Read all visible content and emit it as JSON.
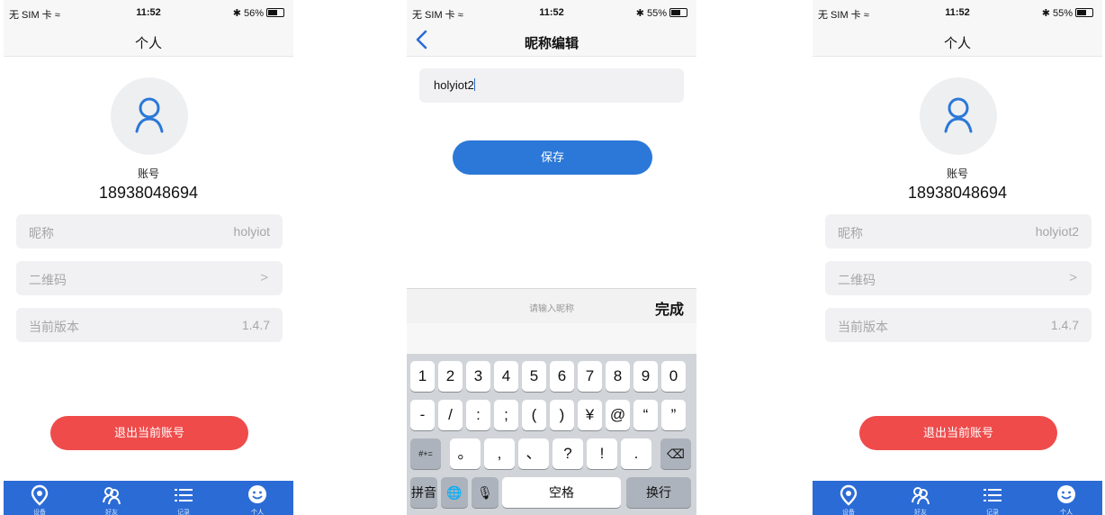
{
  "screens": [
    {
      "status": {
        "carrier": "无 SIM 卡 ≈",
        "time": "11:52",
        "battery": "✱ 56%"
      },
      "title": "个人",
      "account_label": "账号",
      "account_number": "18938048694",
      "rows": [
        {
          "label": "昵称",
          "value": "holyiot"
        },
        {
          "label": "二维码",
          "value": ">"
        },
        {
          "label": "当前版本",
          "value": "1.4.7"
        }
      ],
      "logout_label": "退出当前账号",
      "tabs": [
        "设备",
        "好友",
        "记录",
        "个人"
      ]
    },
    {
      "status": {
        "carrier": "无 SIM 卡 ≈",
        "time": "11:52",
        "battery": "✱ 55%"
      },
      "title": "昵称编辑",
      "input_value": "holyiot2",
      "save_label": "保存",
      "keyboard": {
        "placeholder": "请输入昵称",
        "done": "完成",
        "row1": [
          "1",
          "2",
          "3",
          "4",
          "5",
          "6",
          "7",
          "8",
          "9",
          "0"
        ],
        "row2": [
          "-",
          "/",
          ":",
          ";",
          "(",
          ")",
          "¥",
          "@",
          "“",
          "”"
        ],
        "row3_left": "#+=",
        "row3": [
          "。",
          ",",
          "、",
          "?",
          "!",
          "."
        ],
        "row3_right": "⌫",
        "bottom": {
          "pinyin": "拼音",
          "globe": "🌐",
          "mic": "🎙",
          "space": "空格",
          "return": "换行"
        }
      }
    },
    {
      "status": {
        "carrier": "无 SIM 卡 ≈",
        "time": "11:52",
        "battery": "✱ 55%"
      },
      "title": "个人",
      "account_label": "账号",
      "account_number": "18938048694",
      "rows": [
        {
          "label": "昵称",
          "value": "holyiot2"
        },
        {
          "label": "二维码",
          "value": ">"
        },
        {
          "label": "当前版本",
          "value": "1.4.7"
        }
      ],
      "logout_label": "退出当前账号",
      "tabs": [
        "设备",
        "好友",
        "记录",
        "个人"
      ]
    }
  ],
  "colors": {
    "primary": "#2b6bd6",
    "danger": "#ef4b4b",
    "row_bg": "#f1f1f3"
  }
}
